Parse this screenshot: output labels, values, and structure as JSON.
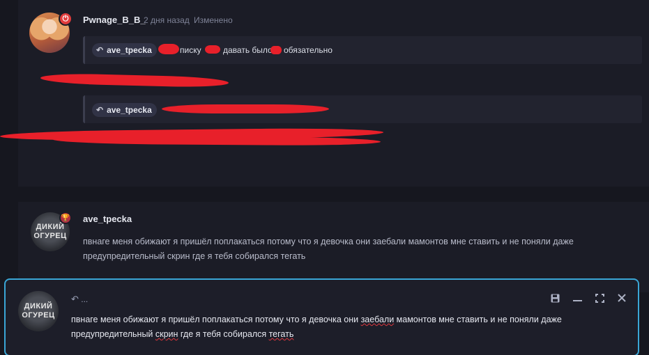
{
  "post1": {
    "username": "Pwnage_B_B_",
    "time": "2 дня назад",
    "edited": "Изменено",
    "quote1": {
      "mention": "ave_tpecka",
      "text_parts": [
        "писку",
        "давать было",
        "обязательно"
      ]
    },
    "quote2": {
      "mention": "ave_tpecka"
    }
  },
  "post2": {
    "username": "ave_tpecka",
    "avatar_text": [
      "ДИКИЙ",
      "ОГУРЕЦ"
    ],
    "lines": [
      "пвнаге меня обижают я пришёл поплакаться потому что я девочка они заебали мамонтов мне ставить и не поняли даже",
      "предупредительный скрин где я тебя собирался тегать"
    ]
  },
  "editor": {
    "reply_label": "...",
    "avatar_text": [
      "ДИКИЙ",
      "ОГУРЕЦ"
    ],
    "line1": {
      "a": "пвнаге меня обижают я пришёл поплакаться потому что я девочка они ",
      "b": "заебали",
      "c": " мамонтов мне ставить и не поняли даже"
    },
    "line2": {
      "a": "предупредительный ",
      "b": "скрин",
      "c": " где я тебя собирался ",
      "d": "тегать"
    }
  },
  "icons": {
    "badge1": "power-icon",
    "badge2": "trophy-icon",
    "reply": "reply-arrow-icon",
    "save": "save-icon",
    "minimize": "minimize-icon",
    "expand": "expand-icon",
    "close": "close-icon"
  },
  "colors": {
    "accent": "#3aa6d6",
    "redaction": "#e8202a",
    "badge": "#e03c3c"
  }
}
